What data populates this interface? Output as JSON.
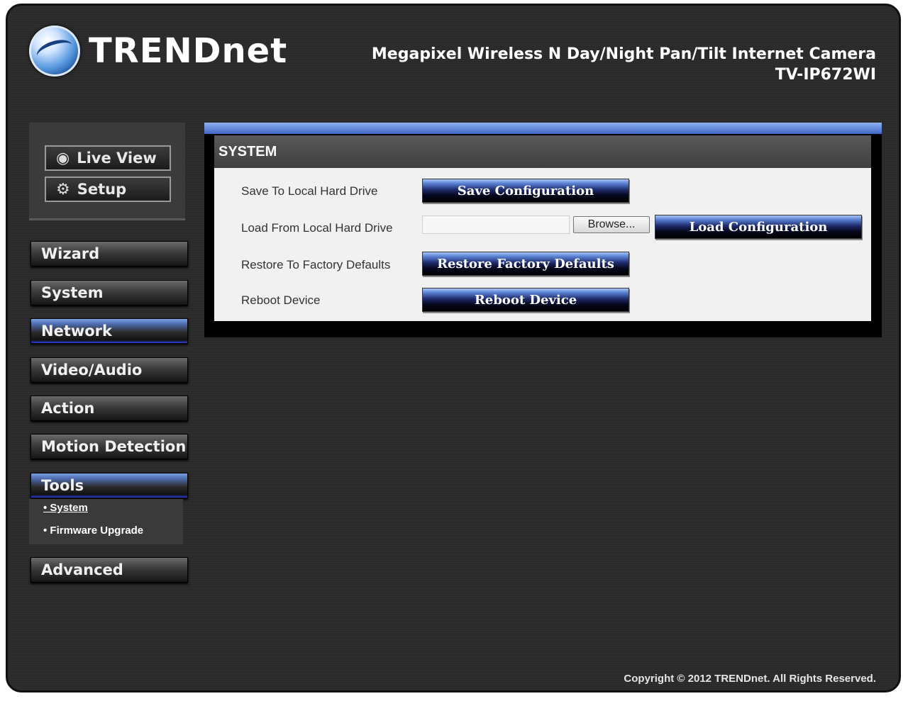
{
  "header": {
    "logo_text": "TRENDnet",
    "product_name": "Megapixel Wireless N Day/Night Pan/Tilt Internet Camera",
    "model": "TV-IP672WI"
  },
  "quick_links": [
    {
      "label": "Live View",
      "icon": "eye-icon"
    },
    {
      "label": "Setup",
      "icon": "gears-icon"
    }
  ],
  "nav": {
    "items": [
      {
        "label": "Wizard"
      },
      {
        "label": "System"
      },
      {
        "label": "Network"
      },
      {
        "label": "Video/Audio"
      },
      {
        "label": "Action"
      },
      {
        "label": "Motion Detection"
      },
      {
        "label": "Tools"
      },
      {
        "label": "Advanced"
      }
    ],
    "submenu": [
      {
        "label": "System"
      },
      {
        "label": "Firmware Upgrade"
      }
    ]
  },
  "panel": {
    "title": "SYSTEM",
    "rows": [
      {
        "label": "Save To Local Hard Drive",
        "button": "Save Configuration"
      },
      {
        "label": "Load From Local Hard Drive",
        "browse": "Browse...",
        "button": "Load Configuration"
      },
      {
        "label": "Restore To Factory Defaults",
        "button": "Restore Factory Defaults"
      },
      {
        "label": "Reboot Device",
        "button": "Reboot Device"
      }
    ]
  },
  "footer": {
    "copyright": "Copyright © 2012 TRENDnet. All Rights Reserved."
  },
  "colors": {
    "accent_blue": "#3f68c6",
    "background": "#2a2a2a"
  }
}
